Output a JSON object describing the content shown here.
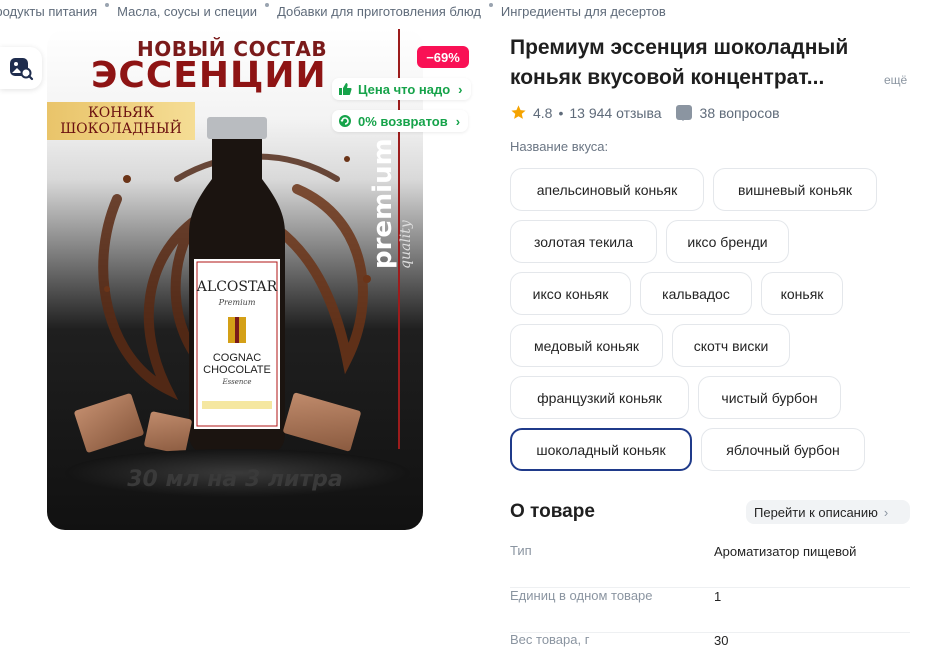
{
  "breadcrumbs": [
    "Продукты питания",
    "Масла, соусы и специи",
    "Добавки для приготовления блюд",
    "Ингредиенты для десертов"
  ],
  "gallery": {
    "photo_text": {
      "headline_1": "НОВЫЙ СОСТАВ",
      "headline_2": "ЭССЕНЦИИ",
      "flavor_tag": "КОНЬЯК ШОКОЛАДНЫЙ",
      "premium": "premium",
      "quality": "quality",
      "caption": "30 мл на 3 литра"
    },
    "discount_badge": "−69%",
    "promo_chips": [
      {
        "label": "Цена что надо",
        "icon": "thumbs-up-icon"
      },
      {
        "label": "0% возвратов",
        "icon": "return-icon"
      }
    ]
  },
  "product": {
    "title": "Премиум эссенция шоколадный коньяк вкусовой концентрат...",
    "more_link": "ещё",
    "rating": "4.8",
    "reviews": "13 944 отзыва",
    "questions": "38 вопросов",
    "flavor_label": "Название вкуса:",
    "flavors": [
      "апельсиновый коньяк",
      "вишневый коньяк",
      "золотая текила",
      "иксо бренди",
      "иксо коньяк",
      "кальвадос",
      "коньяк",
      "медовый коньяк",
      "скотч виски",
      "французкий коньяк",
      "чистый бурбон",
      "шоколадный коньяк",
      "яблочный бурбон"
    ],
    "selected_flavor": "шоколадный коньяк"
  },
  "about": {
    "title": "О товаре",
    "goto_label": "Перейти к описанию",
    "specs": [
      {
        "key": "Тип",
        "value": "Ароматизатор пищевой"
      },
      {
        "key": "Единиц в одном товаре",
        "value": "1"
      },
      {
        "key": "Вес товара, г",
        "value": "30"
      }
    ]
  },
  "colors": {
    "accent": "#1f3a8a",
    "discount": "#f91155",
    "promo_green": "#16a34a",
    "star": "#f5a300"
  }
}
